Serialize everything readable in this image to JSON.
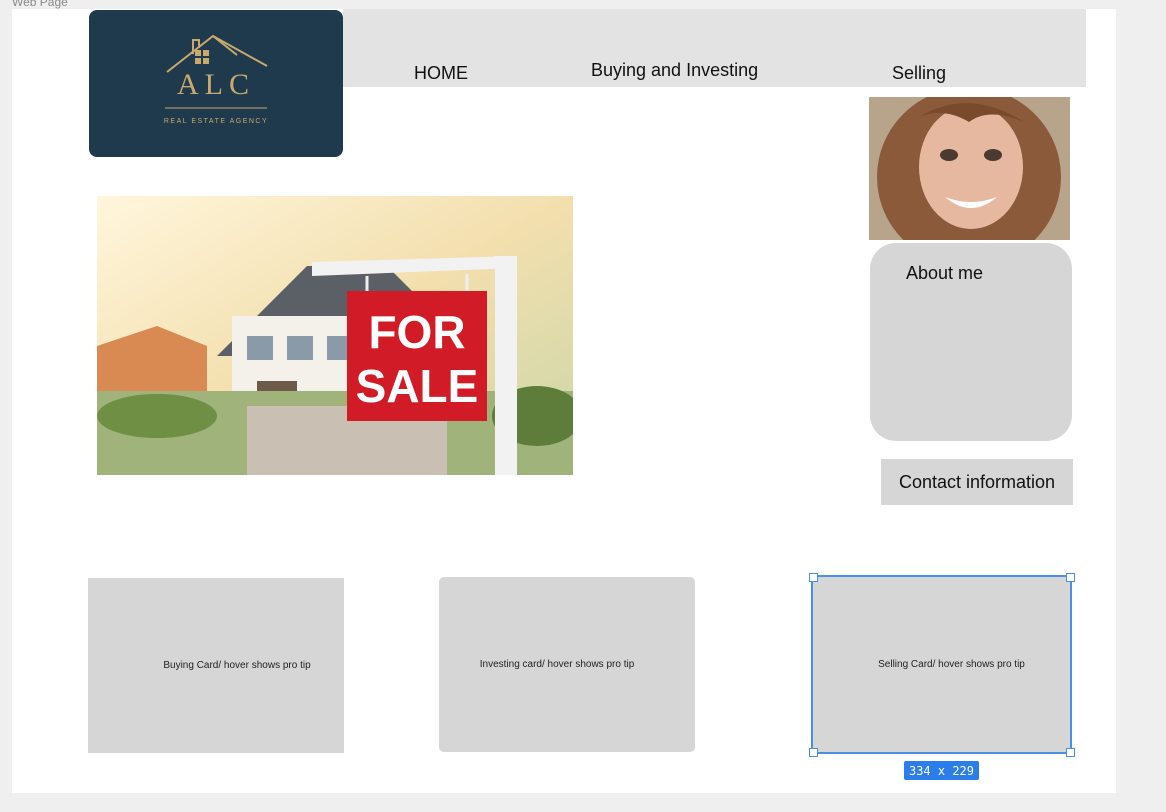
{
  "frame": {
    "label": "Web Page"
  },
  "logo": {
    "brand_text": "ALC",
    "tagline": "REAL ESTATE AGENCY",
    "bg_color": "#1f3a4d",
    "accent_color": "#c8a96e"
  },
  "nav": {
    "items": [
      {
        "label": "HOME"
      },
      {
        "label": "Buying and Investing"
      },
      {
        "label": "Selling"
      }
    ]
  },
  "hero": {
    "sign_text_line1": "FOR",
    "sign_text_line2": "SALE"
  },
  "sidebar": {
    "about_title": "About me",
    "contact_label": "Contact information"
  },
  "cards": [
    {
      "label": "Buying Card/ hover shows pro tip"
    },
    {
      "label": "Investing card/ hover shows pro tip"
    },
    {
      "label": "Selling Card/ hover shows pro tip"
    }
  ],
  "selection": {
    "size_label": "334  x  229",
    "color": "#4a90e2"
  }
}
